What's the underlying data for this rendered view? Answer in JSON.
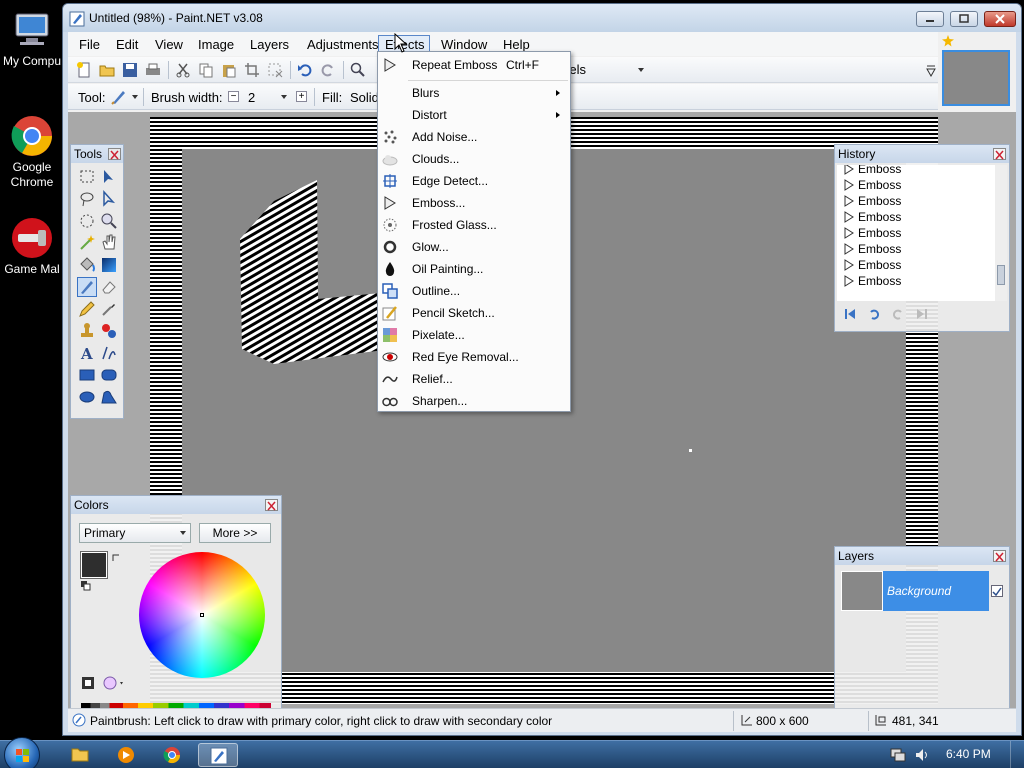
{
  "desktop": {
    "icons": [
      {
        "label": "My Compu",
        "name": "my-computer"
      },
      {
        "label": "Google Chrome",
        "name": "google-chrome"
      },
      {
        "label": "Game Mal",
        "name": "game-maker"
      }
    ]
  },
  "window": {
    "title": "Untitled (98%) - Paint.NET v3.08"
  },
  "menubar": {
    "items": [
      "File",
      "Edit",
      "View",
      "Image",
      "Layers",
      "Adjustments",
      "Effects",
      "Window",
      "Help"
    ],
    "active": "Effects"
  },
  "toolbar1": {
    "units_fragment": "ixels"
  },
  "toolbar2": {
    "tool_label": "Tool:",
    "brush_width_label": "Brush width:",
    "brush_width_value": "2",
    "fill_label": "Fill:",
    "fill_value": "Solid"
  },
  "effects_menu": {
    "repeat": {
      "label": "Repeat Emboss",
      "shortcut": "Ctrl+F"
    },
    "submenus": [
      "Blurs",
      "Distort"
    ],
    "items": [
      "Add Noise...",
      "Clouds...",
      "Edge Detect...",
      "Emboss...",
      "Frosted Glass...",
      "Glow...",
      "Oil Painting...",
      "Outline...",
      "Pencil Sketch...",
      "Pixelate...",
      "Red Eye Removal...",
      "Relief...",
      "Sharpen..."
    ]
  },
  "tools_panel": {
    "title": "Tools"
  },
  "history_panel": {
    "title": "History",
    "items": [
      "Emboss",
      "Emboss",
      "Emboss",
      "Emboss",
      "Emboss",
      "Emboss",
      "Emboss",
      "Emboss"
    ]
  },
  "colors_panel": {
    "title": "Colors",
    "selector_value": "Primary",
    "more_button": "More >>"
  },
  "layers_panel": {
    "title": "Layers",
    "layer_name": "Background",
    "layer_visible": true
  },
  "statusbar": {
    "hint": "Paintbrush: Left click to draw with primary color, right click to draw with secondary color",
    "image_size": "800 x 600",
    "cursor_pos": "481, 341"
  },
  "taskbar": {
    "clock": "6:40 PM"
  },
  "colors": {
    "accent": "#3d8ee6",
    "canvas": "#888888"
  }
}
